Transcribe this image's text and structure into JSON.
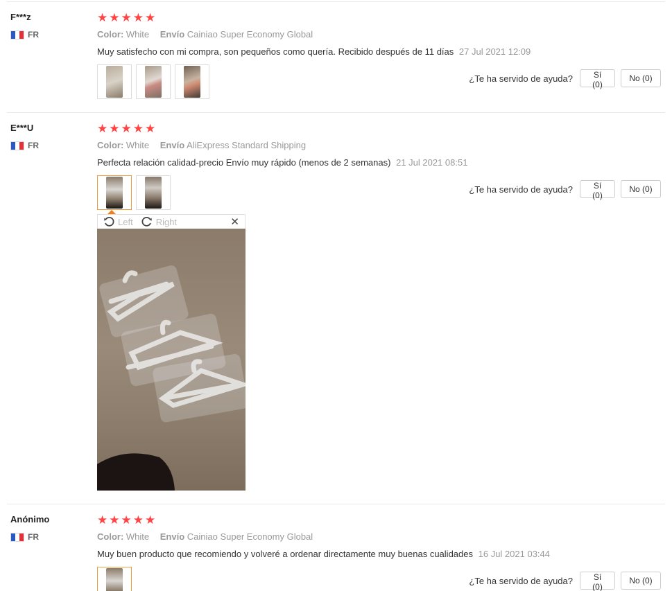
{
  "reviews": [
    {
      "user": "F***z",
      "country": "FR",
      "stars": [
        "★",
        "★",
        "★",
        "★",
        "★"
      ],
      "color_label": "Color:",
      "color_value": "White",
      "shipping_label": "Envío",
      "shipping_value": "Cainiao Super Economy Global",
      "text": "Muy satisfecho con mi compra, son pequeños como quería. Recibido después de 11 días",
      "date": "27 Jul 2021 12:09",
      "helpful_question": "¿Te ha servido de ayuda?",
      "yes_label": "Sí (0)",
      "no_label": "No (0)"
    },
    {
      "user": "E***U",
      "country": "FR",
      "stars": [
        "★",
        "★",
        "★",
        "★",
        "★"
      ],
      "color_label": "Color:",
      "color_value": "White",
      "shipping_label": "Envío",
      "shipping_value": "AliExpress Standard Shipping",
      "text": "Perfecta relación calidad-precio Envío muy rápido (menos de 2 semanas)",
      "date": "21 Jul 2021 08:51",
      "helpful_question": "¿Te ha servido de ayuda?",
      "yes_label": "Sí (0)",
      "no_label": "No (0)"
    },
    {
      "user": "Anónimo",
      "country": "FR",
      "stars": [
        "★",
        "★",
        "★",
        "★",
        "★"
      ],
      "color_label": "Color:",
      "color_value": "White",
      "shipping_label": "Envío",
      "shipping_value": "Cainiao Super Economy Global",
      "text": "Muy buen producto que recomiendo y volveré a ordenar directamente muy buenas cualidades",
      "date": "16 Jul 2021 03:44",
      "helpful_question": "¿Te ha servido de ayuda?",
      "yes_label": "Sí (0)",
      "no_label": "No (0)"
    }
  ],
  "viewer": {
    "rotate_left": "Left",
    "rotate_right": "Right",
    "close": "✕"
  },
  "colors": {
    "star": "#ff4747",
    "active_thumb_border": "#e9a23b",
    "flag_blue": "#2b59c3",
    "flag_red": "#e0323a"
  }
}
